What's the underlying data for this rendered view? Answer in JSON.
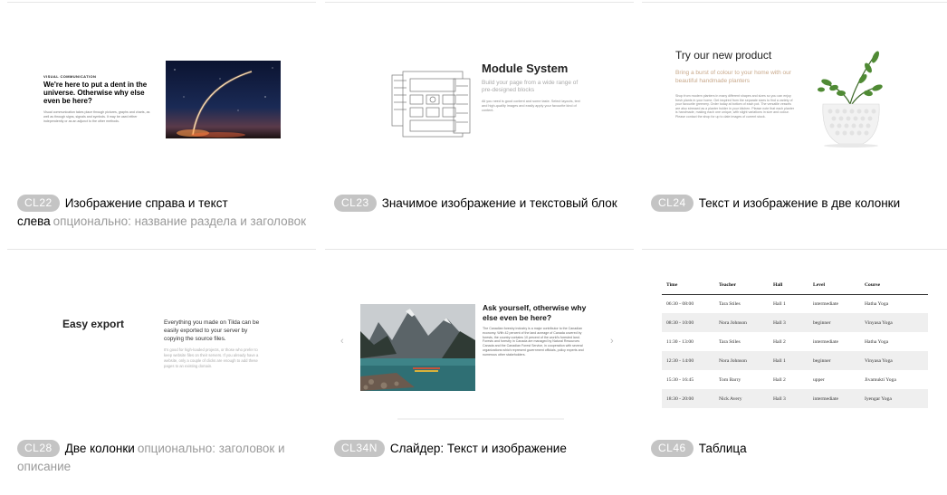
{
  "cards": {
    "cl22": {
      "badge": "CL22",
      "title": "Изображение справа и текст слева",
      "subtitle": "опционально: название раздела и заголовок",
      "preview": {
        "eyebrow": "VISUAL COMMUNICATION",
        "heading": "We're here to put a dent in the universe. Otherwise why else even be here?",
        "body": "Visual communication takes place through pictures, graphs and charts, as well as through signs, signals and symbols. It may be used either independently or as an adjunct to the other methods."
      }
    },
    "cl23": {
      "badge": "CL23",
      "title": "Значимое изображение и текстовый блок",
      "preview": {
        "heading": "Module System",
        "sub": "Build your page from a wide range of pre-designed blocks",
        "body": "All you need is good content and some taste. Select layouts, text and high-quality images and easily apply your favourite kind of content."
      }
    },
    "cl24": {
      "badge": "CL24",
      "title": "Текст и изображение в две колонки",
      "preview": {
        "heading": "Try our new product",
        "sub": "Bring a burst of colour to your home with our beautiful handmade planters",
        "body": "Shop from modern planters in many different shapes and sizes so you can enjoy fresh plants in your home. Get inspired from the separate sizes to find a variety of your favourite greenery. Order today at bottom of each pot. The versatile vessels are also stressed as a planter holder in your kitchen. Please note that each planter is handmade, making each one unique, with slight variations in size and colour. Please contact the shop for up to date images of current stock."
      }
    },
    "cl28": {
      "badge": "CL28",
      "title": "Две колонки",
      "subtitle": "опционально: заголовок и описание",
      "preview": {
        "heading": "Easy export",
        "lead": "Everything you made on Tilda can be easily exported to your server by copying the source files.",
        "body": "It's good for high-loaded projects, or those who prefer to keep website files on their servers. If you already have a website, only a couple of clicks are enough to add these pages to an existing domain."
      }
    },
    "cl34n": {
      "badge": "CL34N",
      "title": "Слайдер: Текст и изображение",
      "preview": {
        "heading": "Ask yourself, otherwise why else even be here?",
        "body": "The Canadian forestry industry is a major contributor to the Canadian economy. With 42 percent of the land acreage of Canada covered by forests, the country contains 10 percent of the world's forested land. Forests and forestry in Canada are managed by Natural Resources Canada and the Canadian Forest Service, in cooperation with several organizations which represent government officials, policy experts and numerous other stakeholders.",
        "prev_arrow": "‹",
        "next_arrow": "›"
      }
    },
    "cl46": {
      "badge": "CL46",
      "title": "Таблица",
      "preview": {
        "headers": [
          "Time",
          "Teacher",
          "Hall",
          "Level",
          "Course"
        ],
        "rows": [
          [
            "06:30 - 08:00",
            "Tara Stiles",
            "Hall 1",
            "intermediate",
            "Hatha Yoga"
          ],
          [
            "08:30 - 10:00",
            "Nora Johnson",
            "Hall 3",
            "beginner",
            "Vinyasa Yoga"
          ],
          [
            "11:30 - 13:00",
            "Tara Stiles",
            "Hall 2",
            "intermediate",
            "Hatha Yoga"
          ],
          [
            "12:30 - 14:00",
            "Nora Johnson",
            "Hall 1",
            "beginner",
            "Vinyasa Yoga"
          ],
          [
            "15:30 - 16:45",
            "Tom Barry",
            "Hall 2",
            "upper",
            "Jivamukti Yoga"
          ],
          [
            "18:30 - 20:00",
            "Nick Avery",
            "Hall 3",
            "intermediate",
            "Iyengar Yoga"
          ]
        ]
      }
    }
  },
  "colors": {
    "badge_bg": "#c4c4c4",
    "subtitle": "#9a9a9a",
    "divider": "#e6e6e6",
    "table_alt_row": "#efefef"
  }
}
